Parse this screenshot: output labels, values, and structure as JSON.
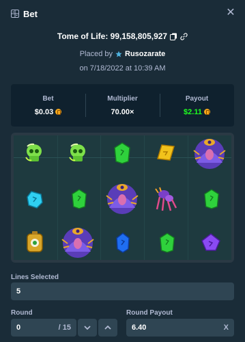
{
  "header": {
    "title": "Bet",
    "close_icon": "close-icon"
  },
  "game": {
    "name": "Tome of Life: 99,158,805,927"
  },
  "placed": {
    "prefix": "Placed by",
    "user": "Rusozarate"
  },
  "date": {
    "text": "on 7/18/2022 at 10:39 AM"
  },
  "stats": {
    "bet_label": "Bet",
    "bet_value": "$0.03",
    "multiplier_label": "Multiplier",
    "multiplier_value": "70.00×",
    "payout_label": "Payout",
    "payout_value": "$2.11"
  },
  "board": {
    "rows": [
      [
        "green-skull",
        "green-skull",
        "green-gem",
        "yellow-gem",
        "purple-sorceress"
      ],
      [
        "blue-gem",
        "green-gem",
        "purple-sorceress",
        "purple-spider",
        "green-gem"
      ],
      [
        "gold-amulet",
        "purple-sorceress",
        "blue-gem",
        "green-gem",
        "purple-gem"
      ]
    ]
  },
  "lines": {
    "label": "Lines Selected",
    "value": "5"
  },
  "round": {
    "label": "Round",
    "value": "0",
    "suffix": "/ 15"
  },
  "round_payout": {
    "label": "Round Payout",
    "value": "6.40",
    "suffix": "X"
  },
  "colors": {
    "background": "#1a2c38",
    "panel": "#0f212e",
    "input": "#2f4553",
    "payout_green": "#1fff20",
    "coin": "#f7a81a"
  }
}
